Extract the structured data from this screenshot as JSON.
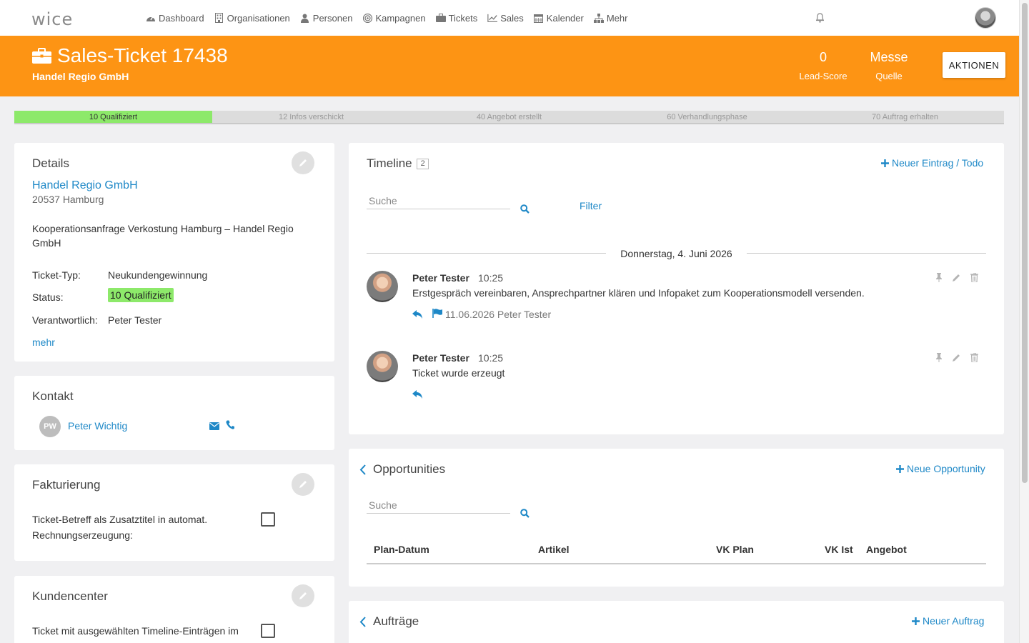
{
  "app": {
    "logo": "wice"
  },
  "nav": [
    {
      "label": "Dashboard",
      "icon": "dashboard-icon"
    },
    {
      "label": "Organisationen",
      "icon": "building-icon"
    },
    {
      "label": "Personen",
      "icon": "person-icon"
    },
    {
      "label": "Kampagnen",
      "icon": "target-icon"
    },
    {
      "label": "Tickets",
      "icon": "briefcase-icon"
    },
    {
      "label": "Sales",
      "icon": "chart-icon"
    },
    {
      "label": "Kalender",
      "icon": "calendar-icon"
    },
    {
      "label": "Mehr",
      "icon": "sitemap-icon"
    }
  ],
  "header": {
    "title": "Sales-Ticket 17438",
    "subtitle": "Handel Regio GmbH",
    "lead_score_value": "0",
    "lead_score_label": "Lead-Score",
    "source_value": "Messe",
    "source_label": "Quelle",
    "actions_label": "AKTIONEN",
    "color": "#fd9414"
  },
  "stages": [
    {
      "label": "10 Qualifiziert",
      "active": true
    },
    {
      "label": "12 Infos verschickt",
      "active": false
    },
    {
      "label": "40 Angebot erstellt",
      "active": false
    },
    {
      "label": "60 Verhandlungsphase",
      "active": false
    },
    {
      "label": "70 Auftrag erhalten",
      "active": false
    }
  ],
  "details": {
    "title": "Details",
    "company": "Handel Regio GmbH",
    "address": "20537 Hamburg",
    "description": "Kooperationsanfrage Verkostung Hamburg – Handel Regio GmbH",
    "type_label": "Ticket-Typ:",
    "type_value": "Neukundengewinnung",
    "status_label": "Status:",
    "status_value": "10 Qualifiziert",
    "owner_label": "Verantwortlich:",
    "owner_value": "Peter Tester",
    "more_link": "mehr"
  },
  "kontakt": {
    "title": "Kontakt",
    "initials": "PW",
    "name": "Peter Wichtig"
  },
  "faktur": {
    "title": "Fakturierung",
    "checkbox_label": "Ticket-Betreff als Zusatztitel in automat. Rechnungserzeugung:"
  },
  "kunden": {
    "title": "Kundencenter",
    "checkbox_label": "Ticket mit ausgewählten Timeline-Einträgen im Kundencenter sichtbar"
  },
  "timeline": {
    "title": "Timeline",
    "count": "2",
    "new_entry": "Neuer Eintrag / Todo",
    "search_placeholder": "Suche",
    "filter": "Filter",
    "date": "Donnerstag, 4. Juni 2026",
    "entries": [
      {
        "author": "Peter Tester",
        "time": "10:25",
        "text": "Erstgespräch vereinbaren, Ansprechpartner klären und Infopaket zum Kooperationsmodell versenden.",
        "due": "11.06.2026 Peter Tester"
      },
      {
        "author": "Peter Tester",
        "time": "10:25",
        "text": "Ticket wurde erzeugt",
        "due": ""
      }
    ]
  },
  "opps": {
    "title": "Opportunities",
    "new_label": "Neue Opportunity",
    "search_placeholder": "Suche",
    "columns": [
      "Plan-Datum",
      "Artikel",
      "VK Plan",
      "VK Ist",
      "Angebot"
    ]
  },
  "auftraege": {
    "title": "Aufträge",
    "new_label": "Neuer Auftrag"
  }
}
